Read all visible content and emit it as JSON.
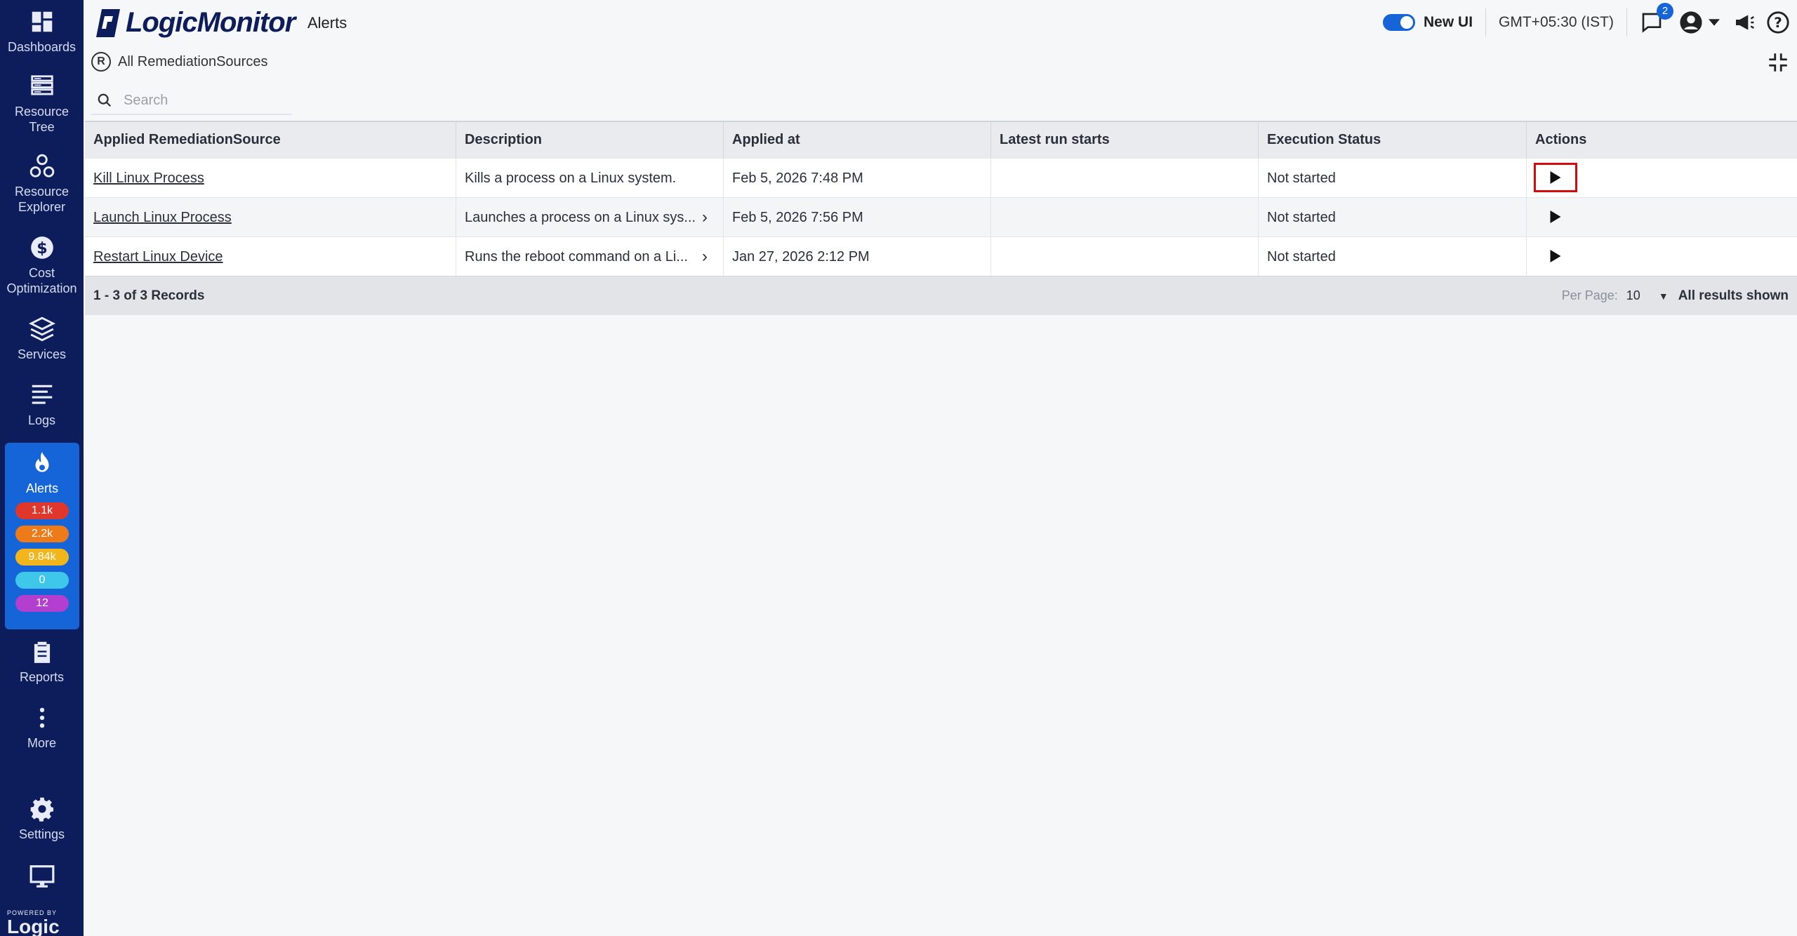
{
  "sidebar": {
    "items": [
      {
        "label": "Dashboards"
      },
      {
        "label": "Resource Tree"
      },
      {
        "label": "Resource Explorer"
      },
      {
        "label": "Cost Optimization"
      },
      {
        "label": "Services"
      },
      {
        "label": "Logs"
      },
      {
        "label": "Alerts"
      },
      {
        "label": "Reports"
      },
      {
        "label": "More"
      },
      {
        "label": "Settings"
      }
    ],
    "alert_badges": [
      {
        "value": "1.1k",
        "color": "#e0372c"
      },
      {
        "value": "2.2k",
        "color": "#ee7b1a"
      },
      {
        "value": "9.84k",
        "color": "#f2b61c"
      },
      {
        "value": "0",
        "color": "#3fc7ea"
      },
      {
        "value": "12",
        "color": "#b23fcf"
      }
    ],
    "powered_by": "POWERED BY",
    "powered_brand": "Logic Monitor"
  },
  "header": {
    "brand": "LogicMonitor",
    "page_title": "Alerts",
    "new_ui_label": "New UI",
    "timezone": "GMT+05:30 (IST)",
    "notification_count": "2"
  },
  "breadcrumb": {
    "icon_letter": "R",
    "label": "All RemediationSources"
  },
  "search": {
    "placeholder": "Search"
  },
  "table": {
    "columns": [
      "Applied RemediationSource",
      "Description",
      "Applied at",
      "Latest run starts",
      "Execution Status",
      "Actions"
    ],
    "rows": [
      {
        "name": "Kill Linux Process",
        "description": "Kills a process on a Linux system.",
        "applied_at": "Feb 5, 2026 7:48 PM",
        "latest_run": "",
        "status": "Not started"
      },
      {
        "name": "Launch Linux Process",
        "description": "Launches a process on a Linux sys...",
        "applied_at": "Feb 5, 2026 7:56 PM",
        "latest_run": "",
        "status": "Not started"
      },
      {
        "name": "Restart Linux Device",
        "description": "Runs the reboot command on a Li...",
        "applied_at": "Jan 27, 2026 2:12 PM",
        "latest_run": "",
        "status": "Not started"
      }
    ],
    "footer": {
      "records": "1 - 3 of 3 Records",
      "per_page_label": "Per Page:",
      "per_page_value": "10",
      "all_results": "All results shown"
    }
  }
}
